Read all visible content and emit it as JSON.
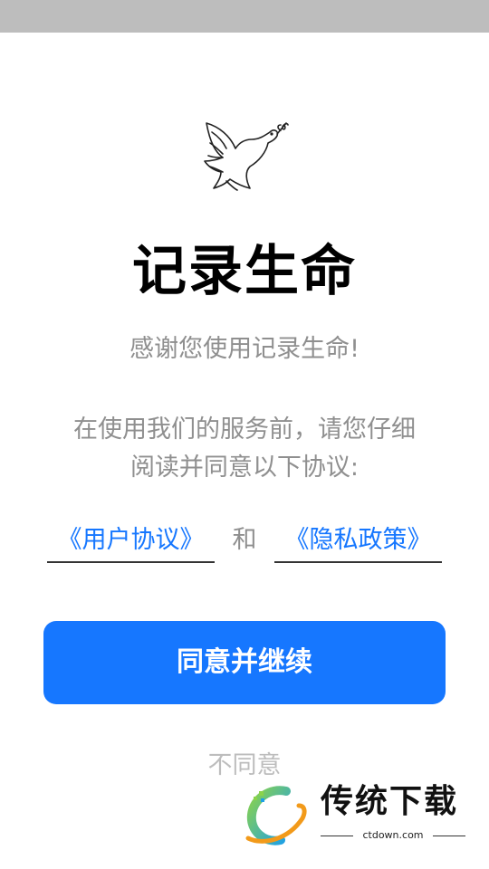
{
  "app": {
    "title": "记录生命",
    "thanks": "感谢您使用记录生命!",
    "notice_line1": "在使用我们的服务前，请您仔细",
    "notice_line2": "阅读并同意以下协议:",
    "links": {
      "user_agreement": "《用户协议》",
      "and": "和",
      "privacy_policy": "《隐私政策》"
    },
    "agree_button": "同意并继续",
    "disagree_button": "不同意"
  },
  "watermark": {
    "title": "传统下载",
    "url": "ctdown.com"
  },
  "colors": {
    "accent": "#1677ff",
    "muted_text": "#8f8f8f",
    "status_bar": "#bdbdbd"
  },
  "icons": {
    "logo": "dove-with-olive-branch-icon"
  }
}
